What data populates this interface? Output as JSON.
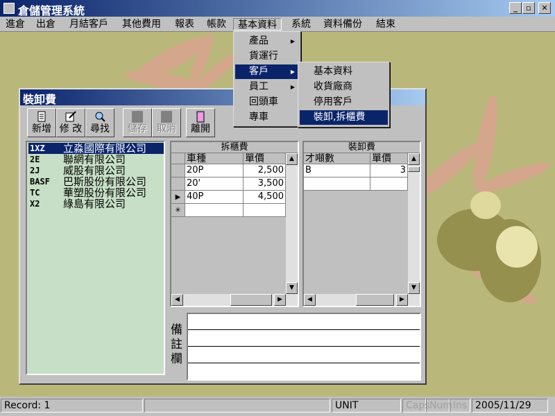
{
  "app": {
    "title": "倉儲管理系統"
  },
  "window_buttons": {
    "minimize": "_",
    "restore": "▫",
    "close": "✕"
  },
  "menubar": {
    "items": [
      "進倉",
      "出倉",
      "月結客戶",
      "其他費用",
      "報表",
      "帳款",
      "基本資料",
      "系統",
      "資料備份",
      "結束"
    ],
    "active": "基本資料"
  },
  "basic_menu": {
    "items": [
      {
        "label": "產品",
        "submenu": true
      },
      {
        "label": "貨運行",
        "submenu": false
      },
      {
        "label": "客戶",
        "submenu": true,
        "highlighted": true
      },
      {
        "label": "員工",
        "submenu": true
      },
      {
        "label": "回頭車",
        "submenu": false
      },
      {
        "label": "專車",
        "submenu": false
      }
    ]
  },
  "customer_submenu": {
    "items": [
      "基本資料",
      "收貨廠商",
      "停用客戶",
      "裝卸,拆櫃費"
    ],
    "highlighted": "裝卸,拆櫃費"
  },
  "subwindow": {
    "title": "裝卸費",
    "toolbar": [
      {
        "label": "新增",
        "icon": "new-document-icon",
        "enabled": true
      },
      {
        "label": "修 改",
        "icon": "edit-icon",
        "enabled": true
      },
      {
        "label": "尋找",
        "icon": "magnifier-icon",
        "enabled": true
      },
      {
        "label": "儲存",
        "icon": "save-icon",
        "enabled": false
      },
      {
        "label": "取消",
        "icon": "cancel-icon",
        "enabled": false
      },
      {
        "label": "離開",
        "icon": "exit-door-icon",
        "enabled": true
      }
    ],
    "customers": [
      {
        "code": "1XZ",
        "name": "立淼國際有限公司",
        "selected": true
      },
      {
        "code": "2E",
        "name": "聯網有限公司"
      },
      {
        "code": "2J",
        "name": "威股有限公司"
      },
      {
        "code": "BASF",
        "name": "巴斯股份有限公司"
      },
      {
        "code": "TC",
        "name": "華塑股份有限公司"
      },
      {
        "code": "X2",
        "name": "綠島有限公司"
      }
    ],
    "unpack_grid": {
      "caption": "拆櫃費",
      "columns": [
        "車種",
        "單價"
      ],
      "rows": [
        {
          "type": "20P",
          "price": "2,500",
          "marker": ""
        },
        {
          "type": "20'",
          "price": "3,500",
          "marker": ""
        },
        {
          "type": "40P",
          "price": "4,500",
          "marker": "▶"
        },
        {
          "type": "",
          "price": "",
          "marker": "✳"
        }
      ]
    },
    "loading_grid": {
      "caption": "裝卸費",
      "columns": [
        "才噸數",
        "單價"
      ],
      "rows": [
        {
          "tonnage": "B",
          "price": "3"
        },
        {
          "tonnage": "",
          "price": ""
        }
      ]
    },
    "memo": {
      "label": "備註欄"
    }
  },
  "statusbar": {
    "record": "Record: 1",
    "blank": "",
    "unit": "UNIT",
    "caps": "Caps",
    "num": "Num",
    "ins": "Ins",
    "date": "2005/11/29"
  },
  "colors": {
    "title_blue": "#0a246a",
    "desktop": "#bab77b",
    "list_bg": "#c6dfc6",
    "face": "#c0c0c0"
  }
}
